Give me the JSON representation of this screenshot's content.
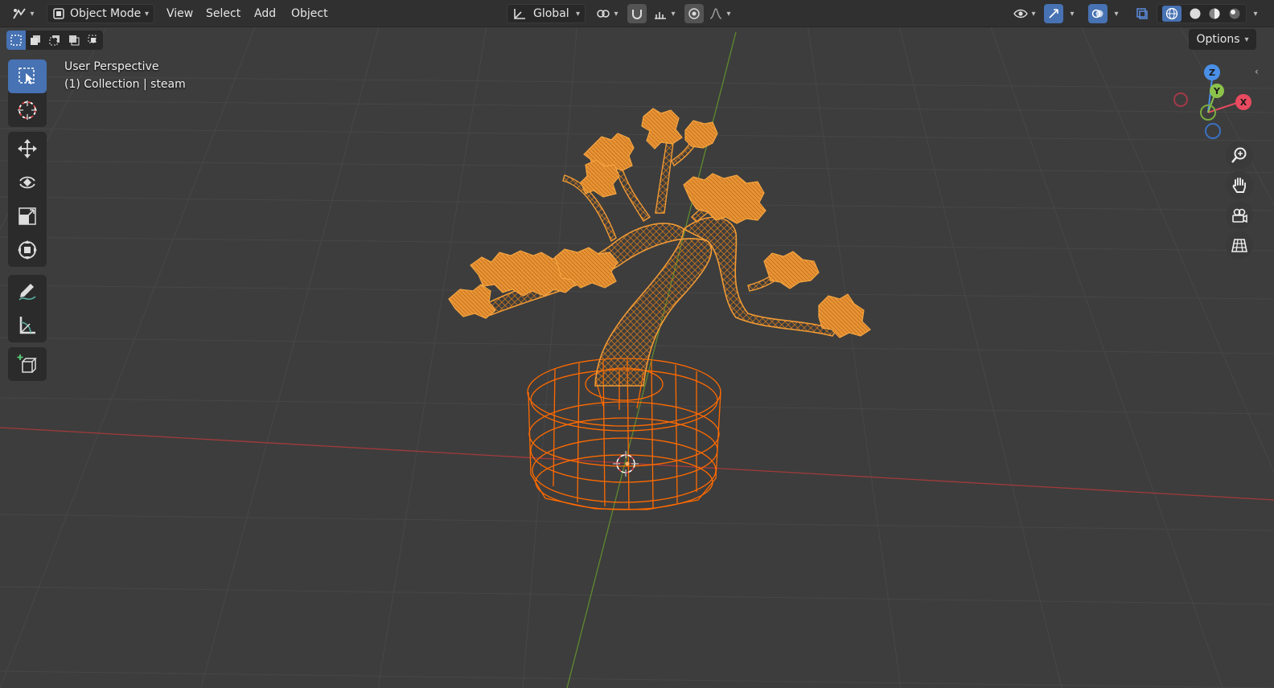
{
  "header": {
    "mode": "Object Mode",
    "menus": [
      "View",
      "Select",
      "Add",
      "Object"
    ],
    "orientation": "Global"
  },
  "toolbar": {
    "options_label": "Options",
    "tools": [
      "select-box",
      "cursor",
      "move",
      "rotate",
      "scale",
      "transform",
      "annotate",
      "measure",
      "add-cube"
    ]
  },
  "viewport": {
    "view_name": "User Perspective",
    "collection_info": "(1) Collection | steam"
  },
  "gizmo": {
    "x_label": "X",
    "y_label": "Y",
    "z_label": "Z"
  },
  "colors": {
    "active_blue": "#4772b3",
    "selected_orange": "#f5962a",
    "active_orange": "#ff6a00",
    "x_axis": "#e84a5f",
    "y_axis": "#8bc34a",
    "z_axis": "#4a8fe8"
  }
}
